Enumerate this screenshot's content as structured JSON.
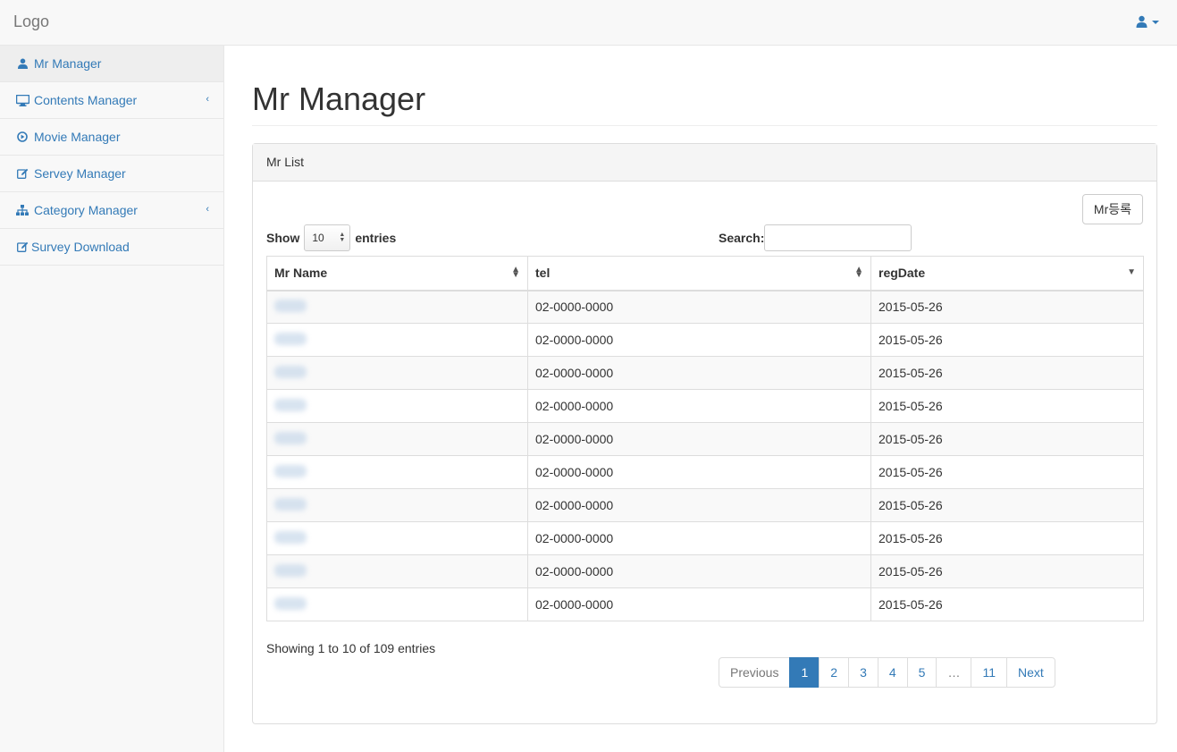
{
  "topbar": {
    "brand": "Logo"
  },
  "sidebar": {
    "items": [
      {
        "label": "Mr Manager",
        "icon": "user-icon",
        "active": true
      },
      {
        "label": "Contents Manager",
        "icon": "monitor-icon",
        "arrow": "‹"
      },
      {
        "label": "Movie Manager",
        "icon": "play-circle-icon"
      },
      {
        "label": "Servey Manager",
        "icon": "edit-icon"
      },
      {
        "label": "Category Manager",
        "icon": "sitemap-icon",
        "arrow": "‹"
      },
      {
        "label": "Survey Download",
        "icon": "edit-icon"
      }
    ]
  },
  "main": {
    "title": "Mr Manager",
    "panel_title": "Mr List",
    "register_button": "Mr등록",
    "length": {
      "prefix": "Show",
      "value": "10",
      "suffix": "entries"
    },
    "search": {
      "label": "Search:",
      "value": ""
    },
    "table": {
      "columns": [
        "Mr Name",
        "tel",
        "regDate"
      ],
      "rows": [
        {
          "tel": "02-0000-0000",
          "date": "2015-05-26"
        },
        {
          "tel": "02-0000-0000",
          "date": "2015-05-26"
        },
        {
          "tel": "02-0000-0000",
          "date": "2015-05-26"
        },
        {
          "tel": "02-0000-0000",
          "date": "2015-05-26"
        },
        {
          "tel": "02-0000-0000",
          "date": "2015-05-26"
        },
        {
          "tel": "02-0000-0000",
          "date": "2015-05-26"
        },
        {
          "tel": "02-0000-0000",
          "date": "2015-05-26"
        },
        {
          "tel": "02-0000-0000",
          "date": "2015-05-26"
        },
        {
          "tel": "02-0000-0000",
          "date": "2015-05-26"
        },
        {
          "tel": "02-0000-0000",
          "date": "2015-05-26"
        }
      ]
    },
    "info": "Showing 1 to 10 of 109 entries",
    "pagination": [
      "Previous",
      "1",
      "2",
      "3",
      "4",
      "5",
      "…",
      "11",
      "Next"
    ]
  },
  "colors": {
    "link": "#337ab7",
    "active_page": "#337ab7"
  }
}
